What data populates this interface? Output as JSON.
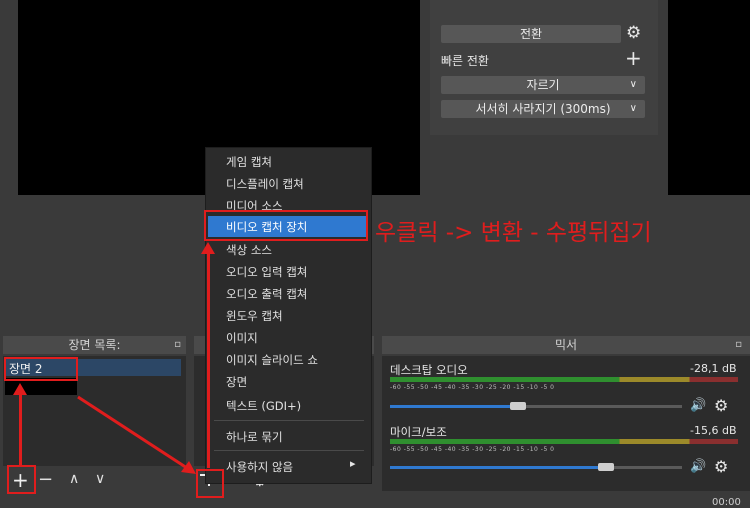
{
  "transition": {
    "button_label": "전환",
    "quick_label": "빠른 전환",
    "select_cut": "자르기",
    "select_fade": "서서히 사라지기 (300ms)"
  },
  "scenes": {
    "title": "장면 목록:",
    "items": [
      "장면 2"
    ]
  },
  "sources": {
    "context_menu": [
      "게임 캡쳐",
      "디스플레이 캡쳐",
      "미디어 소스",
      "비디오 캡처 장치",
      "색상 소스",
      "오디오 입력 캡쳐",
      "오디오 출력 캡쳐",
      "윈도우 캡쳐",
      "이미지",
      "이미지 슬라이드 쇼",
      "장면",
      "텍스트 (GDI+)",
      "하나로 묶기",
      "사용하지 않음"
    ],
    "highlighted_index": 3
  },
  "mixer": {
    "title": "믹서",
    "channels": [
      {
        "name": "데스크탑 오디오",
        "level": "-28,1 dB",
        "volume_fraction": 0.44
      },
      {
        "name": "마이크/보조",
        "level": "-15,6 dB",
        "volume_fraction": 0.74
      }
    ],
    "scale": "-60  -55  -50  -45  -40  -35  -30  -25  -20  -15  -10  -5  0"
  },
  "annotation": {
    "text": "우클릭 -> 변환 - 수평뒤집기",
    "color": "#e01d1d"
  },
  "icons": {
    "gear": "⚙",
    "plus": "+",
    "minus": "−",
    "up": "∧",
    "down": "∨",
    "speaker": "🔊",
    "arrow_right": "▸",
    "dock_float": "▫"
  },
  "status": {
    "partial_time": "00:00"
  }
}
